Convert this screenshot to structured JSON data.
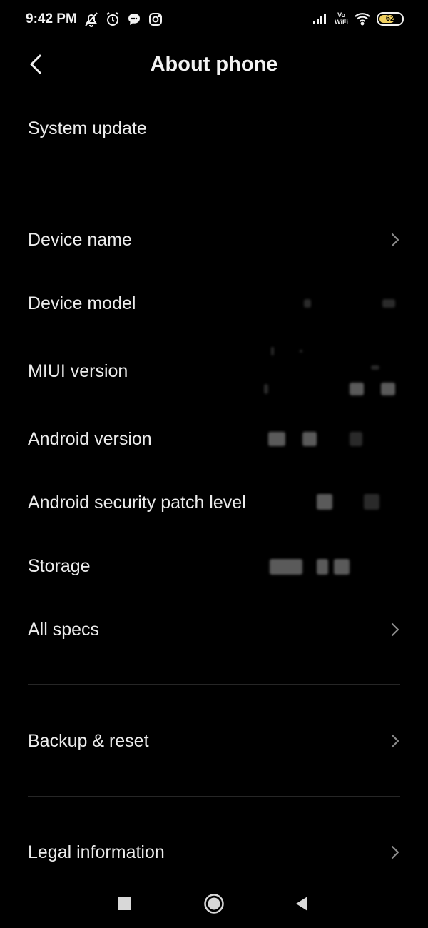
{
  "status_bar": {
    "time": "9:42 PM",
    "left_icons": [
      "mute-bell-icon",
      "alarm-icon",
      "chat-bubble-icon",
      "instagram-icon"
    ],
    "right_icons": [
      "signal-icon",
      "vowifi-icon",
      "wifi-icon",
      "battery-icon"
    ],
    "vowifi_top": "Vo",
    "vowifi_bottom": "WiFi",
    "battery_level": "62"
  },
  "header": {
    "title": "About phone",
    "back_icon": "back-arrow-icon"
  },
  "sections": [
    {
      "items": [
        {
          "label": "System update"
        }
      ]
    },
    {
      "items": [
        {
          "label": "Device name",
          "chevron": true
        },
        {
          "label": "Device model"
        },
        {
          "label": "MIUI version"
        },
        {
          "label": "Android version"
        },
        {
          "label": "Android security patch level"
        },
        {
          "label": "Storage"
        },
        {
          "label": "All specs",
          "chevron": true
        }
      ]
    },
    {
      "items": [
        {
          "label": "Backup & reset",
          "chevron": true
        }
      ]
    },
    {
      "items": [
        {
          "label": "Legal information",
          "chevron": true
        }
      ]
    }
  ],
  "nav_bar": {
    "buttons": [
      "recents-square-icon",
      "home-circle-icon",
      "back-triangle-icon"
    ]
  },
  "colors": {
    "background": "#000000",
    "text": "#ececec",
    "divider": "#262626",
    "battery_fill": "#f0d060"
  }
}
